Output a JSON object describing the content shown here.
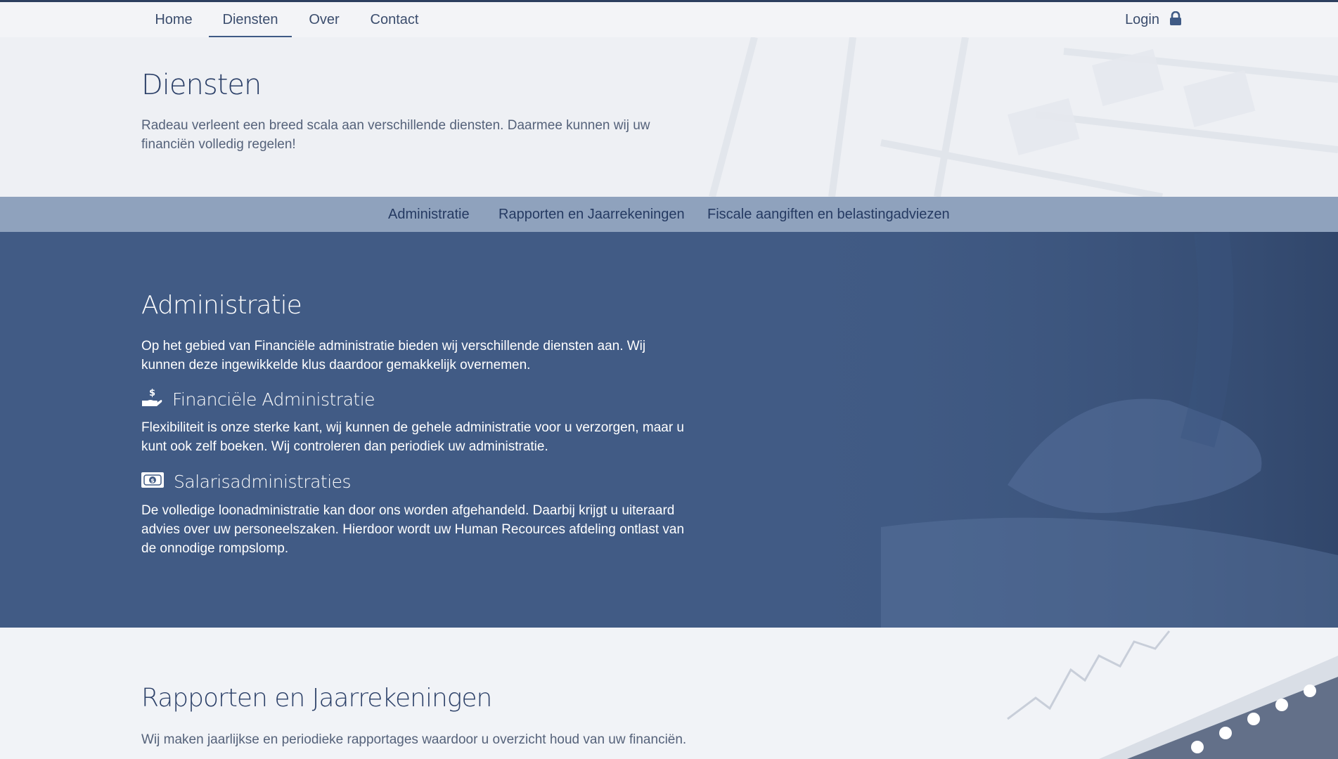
{
  "nav": {
    "items": [
      {
        "label": "Home"
      },
      {
        "label": "Diensten"
      },
      {
        "label": "Over"
      },
      {
        "label": "Contact"
      }
    ],
    "login_label": "Login"
  },
  "hero": {
    "title": "Diensten",
    "text": "Radeau verleent een breed scala aan verschillende diensten. Daarmee kunnen wij uw financiën volledig regelen!"
  },
  "subnav": {
    "items": [
      {
        "label": "Administratie"
      },
      {
        "label": "Rapporten en Jaarrekeningen"
      },
      {
        "label": "Fiscale aangiften en belastingadviezen"
      }
    ]
  },
  "administratie": {
    "title": "Administratie",
    "intro": "Op het gebied van Financiële administratie bieden wij verschillende diensten aan. Wij kunnen deze ingewikkelde klus daardoor gemakkelijk overnemen.",
    "services": [
      {
        "title": "Financiële Administratie",
        "icon": "hand-holding-dollar-icon",
        "text": "Flexibiliteit is onze sterke kant, wij kunnen de gehele administratie voor u verzorgen, maar u kunt ook zelf boeken. Wij controleren dan periodiek uw administratie."
      },
      {
        "title": "Salarisadministraties",
        "icon": "money-bill-icon",
        "text": "De volledige loonadministratie kan door ons worden afgehandeld. Daarbij krijgt u uiteraard advies over uw personeelszaken. Hierdoor wordt uw Human Recources afdeling ontlast van de onnodige rompslomp."
      }
    ]
  },
  "rapporten": {
    "title": "Rapporten en Jaarrekeningen",
    "text": "Wij maken jaarlijkse en periodieke rapportages waardoor u overzicht houd van uw financiën."
  },
  "colors": {
    "primary": "#415b85",
    "subnav": "#8fa2bd",
    "background": "#f1f3f7"
  }
}
